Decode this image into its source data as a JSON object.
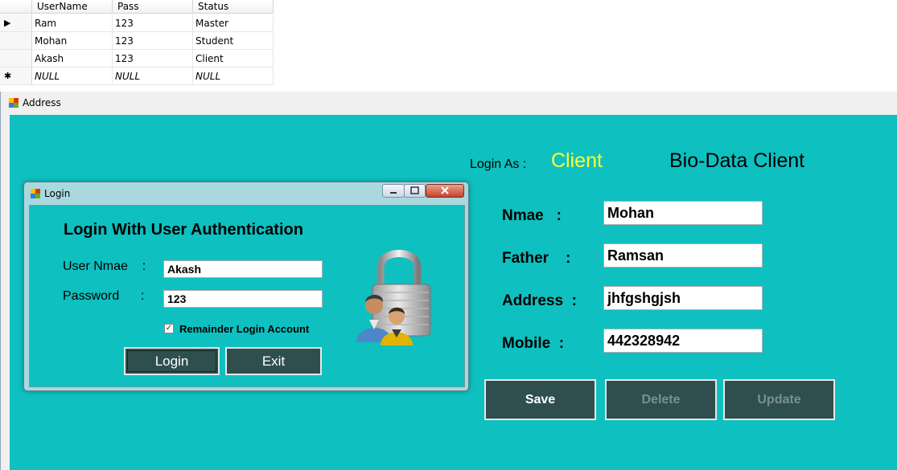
{
  "grid": {
    "columns": [
      "UserName",
      "Pass",
      "Status"
    ],
    "rows": [
      {
        "marker": "▶",
        "cells": [
          "Ram",
          "123",
          "Master"
        ]
      },
      {
        "marker": "",
        "cells": [
          "Mohan",
          "123",
          "Student"
        ]
      },
      {
        "marker": "",
        "cells": [
          "Akash",
          "123",
          "Client"
        ]
      },
      {
        "marker": "✱",
        "cells": [
          "NULL",
          "NULL",
          "NULL"
        ]
      }
    ]
  },
  "address_window": {
    "title": "Address",
    "login_as_label": "Login As  :",
    "login_as_value": "Client",
    "heading": "Bio-Data Client",
    "fields": [
      {
        "label": "Nmae   :",
        "value": "Mohan"
      },
      {
        "label": "Father    :",
        "value": "Ramsan"
      },
      {
        "label": "Address  :",
        "value": "jhfgshgjsh"
      },
      {
        "label": "Mobile  :",
        "value": "442328942"
      }
    ],
    "buttons": {
      "save": "Save",
      "delete": "Delete",
      "update": "Update"
    }
  },
  "login_window": {
    "title": "Login",
    "heading": "Login With User Authentication",
    "username_label": "User Nmae    :",
    "username_value": "Akash",
    "password_label": "Password      :",
    "password_value": "123",
    "remember_label": "Remainder Login Account",
    "remember_checked": true,
    "login_button": "Login",
    "exit_button": "Exit"
  },
  "colors": {
    "client_background": "#0ec0c0",
    "button_background": "#2f4f4f",
    "login_as_value": "#ffff33"
  }
}
